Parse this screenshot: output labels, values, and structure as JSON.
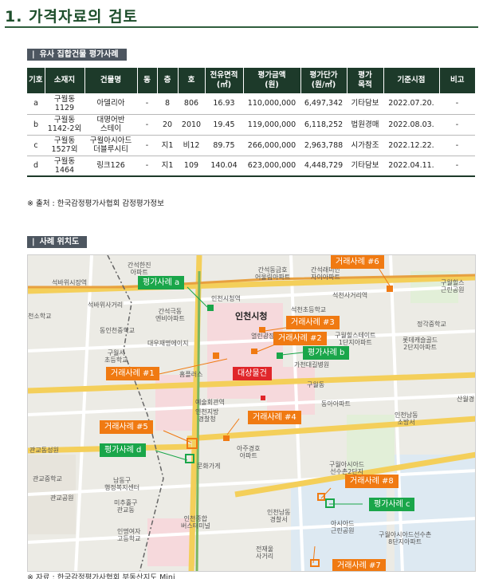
{
  "page": {
    "title": "1. 가격자료의 검토"
  },
  "table_section": {
    "marker": "|",
    "label": "유사 집합건물 평가사례"
  },
  "table": {
    "headers": [
      "기호",
      "소재지",
      "건물명",
      "동",
      "층",
      "호",
      "전유면적\n(㎡)",
      "평가금액\n(원)",
      "평가단가\n(원/㎡)",
      "평가\n목적",
      "기준시점",
      "비고"
    ],
    "rows": [
      [
        "a",
        "구월동\n1129",
        "아델리아",
        "-",
        "8",
        "806",
        "16.93",
        "110,000,000",
        "6,497,342",
        "기타담보",
        "2022.07.20.",
        "-"
      ],
      [
        "b",
        "구월동\n1142-2외",
        "대명어반\n스테이",
        "-",
        "20",
        "2010",
        "19.45",
        "119,000,000",
        "6,118,252",
        "법원경매",
        "2022.08.03.",
        "-"
      ],
      [
        "c",
        "구월동\n1527외",
        "구월아시아드\n더블루시티",
        "-",
        "지1",
        "비12",
        "89.75",
        "266,000,000",
        "2,963,788",
        "시가참조",
        "2022.12.22.",
        "-"
      ],
      [
        "d",
        "구월동\n1464",
        "링크126",
        "-",
        "지1",
        "109",
        "140.04",
        "623,000,000",
        "4,448,729",
        "기타담보",
        "2022.04.11.",
        "-"
      ]
    ]
  },
  "source_note": "※ 출처 : 한국감정평가사협회 감정평가정보",
  "map_section": {
    "marker": "|",
    "label": "사례 위치도"
  },
  "map": {
    "callouts": {
      "sale6": "거래사례 #6",
      "appr_a": "평가사례 a",
      "sale3": "거래사례 #3",
      "sale2": "거래사례 #2",
      "appr_b": "평가사례 b",
      "sale1": "거래사례 #1",
      "target": "대상물건",
      "sale4": "거래사례 #4",
      "sale5": "거래사례 #5",
      "appr_d": "평가사례 d",
      "sale8": "거래사례 #8",
      "appr_c": "평가사례 c",
      "sale7": "거래사례 #7"
    },
    "places": {
      "p1": "간석한진\n아파트",
      "p2": "간석동금호\n어울림아파트",
      "p3": "간석래미안\n자이아파트",
      "p4": "구월힐스\n근린공원",
      "p5": "석바위시장역",
      "p6": "인천시청역",
      "p7": "석천사거리역",
      "p8": "석바위사거리",
      "p9": "간석극동\n엔비아파트",
      "p10": "인천시청",
      "p11": "석천초등학교",
      "p12": "정각중학교",
      "p13": "동인천중학교",
      "p14": "천소학교",
      "p15": "대우재명에이지",
      "p16": "열린광장",
      "p17": "구월힐스테이트\n1단지아파트",
      "p18": "롯데캐슬골드\n2단지아파트",
      "p19": "구월서\n초등학교",
      "p20": "가천대길병원",
      "p21": "구월동",
      "p22": "홈플러스",
      "p23": "예술회관역",
      "p24": "인천지방\n경찰청",
      "p25": "동아아파트",
      "p26": "인천남동\n소방서",
      "p27": "산월경",
      "p28": "관교동성원",
      "p29": "아주경호\n아파트",
      "p30": "구월아시아드\n선수촌2단지",
      "p31": "관교중학교",
      "p32": "남동구\n행정복지센터",
      "p33": "미추홀구\n관교동",
      "p34": "인천남동\n경찰서",
      "p35": "아시아드\n근린공원",
      "p36": "구월아시아드선수촌\n8단지아파트",
      "p37": "인명여자\n고등학교",
      "p38": "전재울\n사거리",
      "p39": "인천종합\n버스터미널",
      "p40": "문화가게",
      "p41": "관교공원"
    }
  },
  "map_credit": "※ 자료 : 한국감정평가사협회 부동산지도 Mini"
}
